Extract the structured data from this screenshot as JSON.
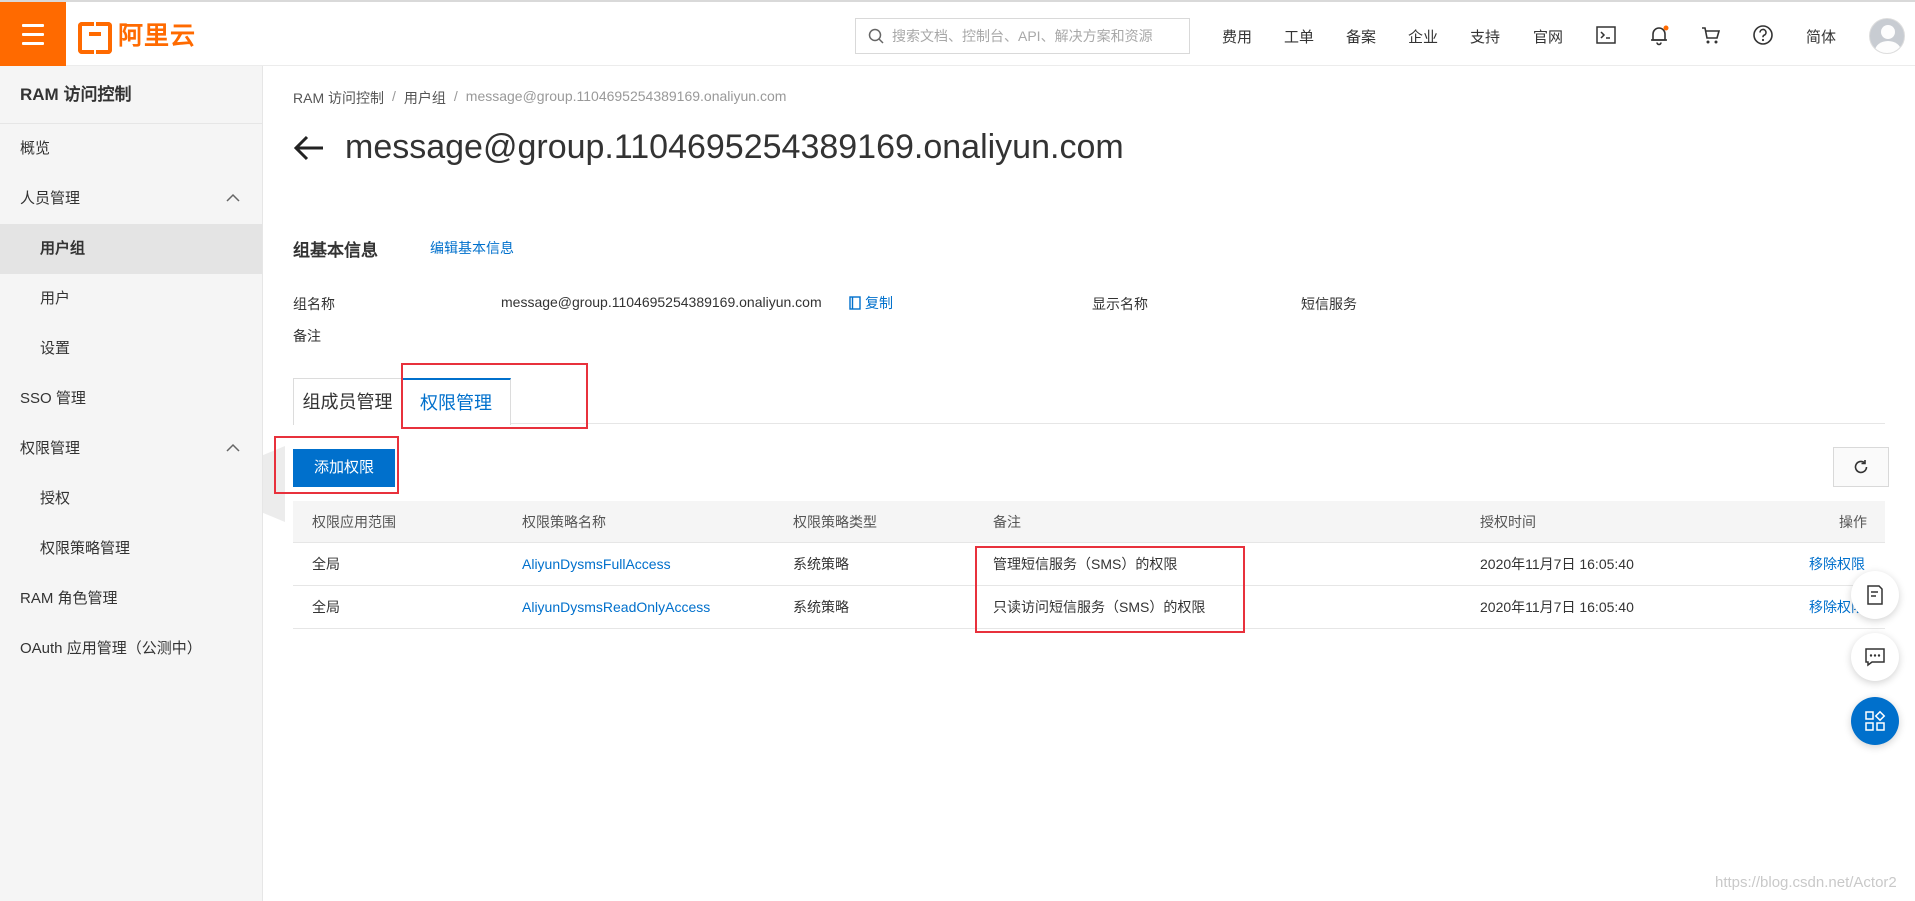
{
  "header": {
    "logo_text": "阿里云",
    "search_placeholder": "搜索文档、控制台、API、解决方案和资源",
    "nav": [
      "费用",
      "工单",
      "备案",
      "企业",
      "支持",
      "官网"
    ],
    "language": "简体",
    "icons": [
      "terminal-icon",
      "bell-icon",
      "cart-icon",
      "help-icon"
    ]
  },
  "sidebar": {
    "title": "RAM 访问控制",
    "items": [
      {
        "label": "概览"
      },
      {
        "label": "人员管理"
      },
      {
        "label": "用户组"
      },
      {
        "label": "用户"
      },
      {
        "label": "设置"
      },
      {
        "label": "SSO 管理"
      },
      {
        "label": "权限管理"
      },
      {
        "label": "授权"
      },
      {
        "label": "权限策略管理"
      },
      {
        "label": "RAM 角色管理"
      },
      {
        "label": "OAuth 应用管理（公测中）"
      }
    ]
  },
  "breadcrumb": [
    "RAM 访问控制",
    "用户组",
    "message@group.1104695254389169.onaliyun.com"
  ],
  "page": {
    "title": "message@group.1104695254389169.onaliyun.com"
  },
  "basic_info": {
    "section_title": "组基本信息",
    "edit_link": "编辑基本信息",
    "group_name_label": "组名称",
    "group_name_value": "message@group.1104695254389169.onaliyun.com",
    "copy_label": "复制",
    "display_name_label": "显示名称",
    "display_name_value": "短信服务",
    "remark_label": "备注"
  },
  "tabs": [
    {
      "label": "组成员管理"
    },
    {
      "label": "权限管理"
    }
  ],
  "toolbar": {
    "add_label": "添加权限"
  },
  "table": {
    "headers": [
      "权限应用范围",
      "权限策略名称",
      "权限策略类型",
      "备注",
      "授权时间",
      "操作"
    ],
    "rows": [
      [
        "全局",
        "AliyunDysmsFullAccess",
        "系统策略",
        "管理短信服务（SMS）的权限",
        "2020年11月7日 16:05:40",
        "移除权限"
      ],
      [
        "全局",
        "AliyunDysmsReadOnlyAccess",
        "系统策略",
        "只读访问短信服务（SMS）的权限",
        "2020年11月7日 16:05:40",
        "移除权限"
      ]
    ]
  },
  "watermark": "https://blog.csdn.net/Actor2",
  "colors": {
    "brand": "#ff6a00",
    "primary": "#0070cc",
    "highlight": "#e8313c"
  }
}
